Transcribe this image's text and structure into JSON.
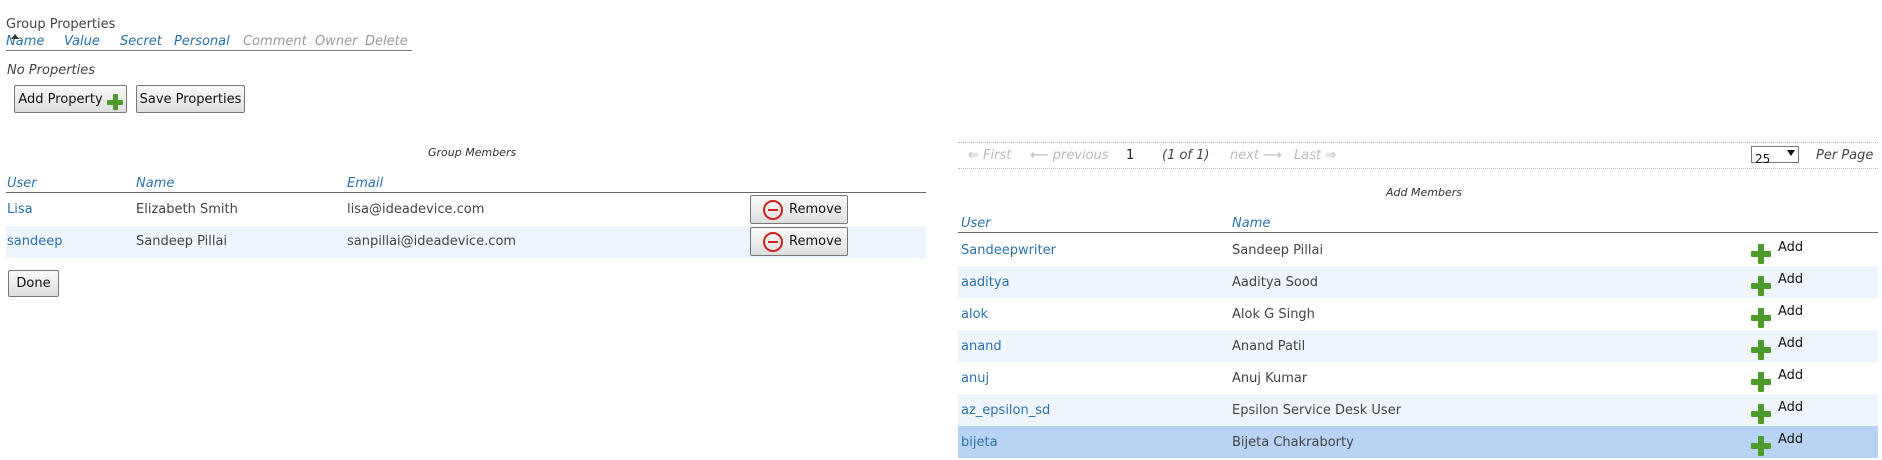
{
  "group_properties": {
    "title": "Group Properties",
    "columns": [
      "Name",
      "Value",
      "Secret",
      "Personal",
      "Comment",
      "Owner",
      "Delete"
    ],
    "empty_text": "No Properties",
    "add_button": "Add Property",
    "save_button": "Save Properties"
  },
  "group_members": {
    "caption": "Group Members",
    "columns": [
      "User",
      "Name",
      "Email"
    ],
    "rows": [
      {
        "user": "Lisa",
        "name": "Elizabeth Smith",
        "email": "lisa@ideadevice.com",
        "action": "Remove"
      },
      {
        "user": "sandeep",
        "name": "Sandeep Pillai",
        "email": "sanpillai@ideadevice.com",
        "action": "Remove"
      }
    ],
    "done_button": "Done"
  },
  "pager": {
    "first": "⇐ First",
    "previous": "⟵ previous",
    "current": "1",
    "of": "(1 of 1)",
    "next": "next ⟶",
    "last": "Last ⇒",
    "per_page_value": "25",
    "per_page_label": "Per Page"
  },
  "add_members": {
    "caption": "Add Members",
    "columns": [
      "User",
      "Name"
    ],
    "rows": [
      {
        "user": "Sandeepwriter",
        "name": "Sandeep Pillai",
        "action": "Add"
      },
      {
        "user": "aaditya",
        "name": "Aaditya Sood",
        "action": "Add"
      },
      {
        "user": "alok",
        "name": "Alok G Singh",
        "action": "Add"
      },
      {
        "user": "anand",
        "name": "Anand Patil",
        "action": "Add"
      },
      {
        "user": "anuj",
        "name": "Anuj Kumar",
        "action": "Add"
      },
      {
        "user": "az_epsilon_sd",
        "name": "Epsilon Service Desk User",
        "action": "Add"
      },
      {
        "user": "bijeta",
        "name": "Bijeta Chakraborty",
        "action": "Add"
      }
    ]
  },
  "colors": {
    "link": "#2a73a8",
    "row_alt": "#eef5fc",
    "row_selected": "#b9d3f4",
    "add_icon": "#4e9a2a",
    "remove_icon": "#cc2222"
  }
}
